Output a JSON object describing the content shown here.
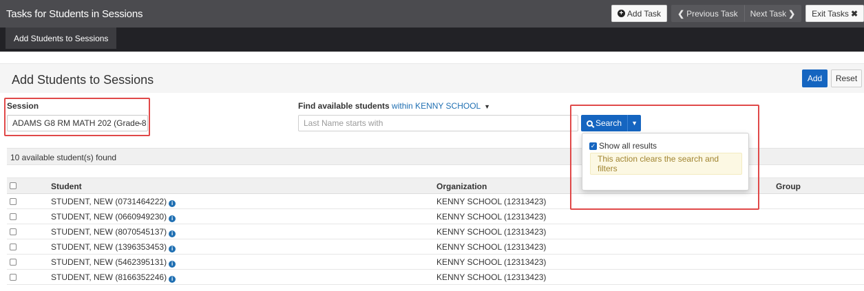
{
  "app": {
    "title": "Tasks for Students in Sessions",
    "add_task": "Add Task",
    "previous_task": "Previous Task",
    "next_task": "Next Task",
    "exit_tasks": "Exit Tasks"
  },
  "subnav": {
    "active_tab": "Add Students to Sessions"
  },
  "page": {
    "title": "Add Students to Sessions",
    "add_button": "Add",
    "reset_button": "Reset"
  },
  "filters": {
    "session_label": "Session",
    "session_value": "ADAMS G8 RM MATH 202 (Grade 8 |",
    "find_label": "Find available students",
    "find_scope": "within KENNY SCHOOL",
    "search_placeholder": "Last Name starts with",
    "search_button": "Search"
  },
  "dropdown": {
    "show_all_label": "Show all results",
    "show_all_checked": true,
    "warning": "This action clears the search and filters"
  },
  "results": {
    "count_text": "10 available student(s) found"
  },
  "table": {
    "headers": {
      "student": "Student",
      "organization": "Organization",
      "group": "Group"
    },
    "rows": [
      {
        "student": "STUDENT, NEW (0731464222)",
        "organization": "KENNY SCHOOL (12313423)"
      },
      {
        "student": "STUDENT, NEW (0660949230)",
        "organization": "KENNY SCHOOL (12313423)"
      },
      {
        "student": "STUDENT, NEW (8070545137)",
        "organization": "KENNY SCHOOL (12313423)"
      },
      {
        "student": "STUDENT, NEW (1396353453)",
        "organization": "KENNY SCHOOL (12313423)"
      },
      {
        "student": "STUDENT, NEW (5462395131)",
        "organization": "KENNY SCHOOL (12313423)"
      },
      {
        "student": "STUDENT, NEW (8166352246)",
        "organization": "KENNY SCHOOL (12313423)"
      }
    ]
  },
  "colors": {
    "primary": "#1565c0",
    "topbar": "#4b4b4f",
    "subnav": "#222226",
    "highlight_border": "#e04848",
    "warning_bg": "#fcf8e3"
  }
}
